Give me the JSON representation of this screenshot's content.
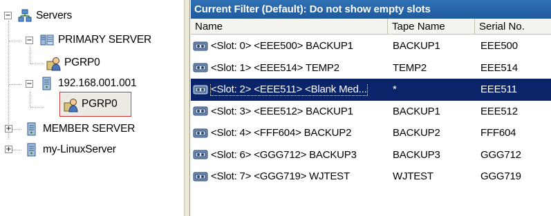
{
  "tree": {
    "root": {
      "label": "Servers",
      "icon": "servers-icon",
      "expander": "−"
    },
    "nodes": [
      {
        "label": "PRIMARY SERVER",
        "icon": "server-group-icon",
        "expander": "−"
      },
      {
        "label": "PGRP0",
        "icon": "pool-user-icon"
      },
      {
        "label": "192.168.001.001",
        "icon": "server-icon",
        "expander": "−"
      },
      {
        "label": "PGRP0",
        "icon": "pool-user-icon",
        "selected": true
      },
      {
        "label": "MEMBER SERVER",
        "icon": "server-icon",
        "expander": "+"
      },
      {
        "label": "my-LinuxServer",
        "icon": "server-icon",
        "expander": "+"
      }
    ]
  },
  "list": {
    "filter_title": "Current Filter (Default):  Do not show empty slots",
    "columns": {
      "name": "Name",
      "tape": "Tape Name",
      "serial": "Serial No."
    },
    "rows": [
      {
        "name": "<Slot:  0> <EEE500> BACKUP1",
        "tape": "BACKUP1",
        "serial": "EEE500"
      },
      {
        "name": "<Slot:  1> <EEE514> TEMP2",
        "tape": "TEMP2",
        "serial": "EEE514"
      },
      {
        "name": "<Slot:  2> <EEE511> <Blank Med...",
        "tape": "*",
        "serial": "EEE511",
        "selected": true
      },
      {
        "name": "<Slot:  3> <EEE512> BACKUP1",
        "tape": "BACKUP1",
        "serial": "EEE512"
      },
      {
        "name": "<Slot:  4> <FFF604> BACKUP2",
        "tape": "BACKUP2",
        "serial": "FFF604"
      },
      {
        "name": "<Slot:  6> <GGG712> BACKUP3",
        "tape": "BACKUP3",
        "serial": "GGG712"
      },
      {
        "name": "<Slot:  7> <GGG719> WJTEST",
        "tape": "WJTEST",
        "serial": "GGG719"
      }
    ]
  },
  "colors": {
    "filter_bar": "#2366a8",
    "selection": "#0a246a",
    "highlight_box": "#d22a2a"
  }
}
